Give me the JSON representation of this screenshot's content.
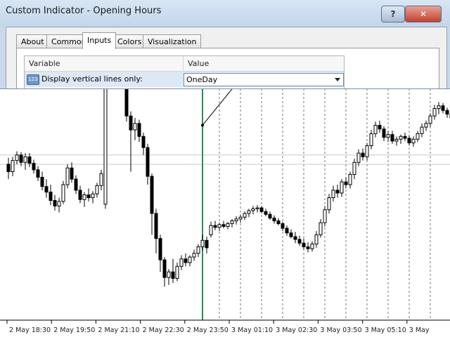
{
  "window": {
    "title": "Custom Indicator - Opening Hours",
    "help_label": "?",
    "close_label": "✕"
  },
  "tabs": [
    {
      "label": "About",
      "active": false
    },
    {
      "label": "Common",
      "active": false
    },
    {
      "label": "Inputs",
      "active": true
    },
    {
      "label": "Colors",
      "active": false
    },
    {
      "label": "Visualization",
      "active": false
    }
  ],
  "inputs_grid": {
    "header_variable": "Variable",
    "header_value": "Value",
    "rows": [
      {
        "icon_text": "123",
        "variable": "Display vertical lines only:",
        "value": "OneDay"
      }
    ]
  },
  "chart_data": {
    "type": "candlestick",
    "x_tick_labels": [
      "2 May 18:30",
      "2 May 19:50",
      "2 May 21:10",
      "2 May 22:30",
      "2 May 23:50",
      "3 May 01:10",
      "3 May 02:30",
      "3 May 03:50",
      "3 May 05:10",
      "3 May"
    ],
    "candles": [
      [
        44.8,
        45.5,
        43.2,
        44.0
      ],
      [
        44.0,
        45.6,
        43.5,
        45.2
      ],
      [
        45.2,
        46.2,
        44.8,
        45.8
      ],
      [
        45.8,
        46.1,
        44.6,
        45.0
      ],
      [
        45.0,
        46.0,
        44.2,
        45.6
      ],
      [
        45.6,
        46.0,
        44.5,
        44.9
      ],
      [
        44.9,
        45.3,
        43.8,
        44.2
      ],
      [
        44.2,
        44.6,
        43.0,
        43.4
      ],
      [
        43.4,
        44.0,
        42.0,
        42.4
      ],
      [
        42.4,
        43.2,
        41.2,
        41.8
      ],
      [
        41.8,
        42.6,
        40.4,
        40.9
      ],
      [
        40.9,
        41.5,
        39.8,
        40.3
      ],
      [
        40.3,
        41.2,
        39.6,
        40.8
      ],
      [
        40.8,
        43.0,
        40.5,
        42.6
      ],
      [
        42.6,
        44.8,
        42.2,
        44.4
      ],
      [
        44.4,
        45.0,
        42.8,
        43.2
      ],
      [
        43.2,
        43.6,
        41.6,
        42.0
      ],
      [
        42.0,
        42.5,
        40.6,
        41.0
      ],
      [
        41.0,
        41.8,
        40.2,
        41.5
      ],
      [
        41.5,
        42.2,
        40.8,
        41.2
      ],
      [
        41.2,
        41.9,
        40.6,
        41.6
      ],
      [
        41.6,
        42.8,
        41.2,
        42.5
      ],
      [
        42.5,
        44.2,
        42.0,
        43.8
      ],
      [
        40.5,
        55.2,
        40.0,
        54.6
      ],
      [
        54.6,
        58.6,
        54.0,
        58.0
      ],
      [
        58.0,
        59.5,
        54.4,
        55.0
      ],
      [
        55.0,
        58.8,
        54.6,
        58.2
      ],
      [
        58.2,
        59.2,
        53.8,
        54.6
      ],
      [
        54.6,
        55.0,
        49.4,
        50.0
      ],
      [
        50.0,
        50.5,
        44.0,
        48.5
      ],
      [
        48.5,
        49.8,
        47.4,
        49.2
      ],
      [
        49.2,
        49.6,
        47.2,
        47.8
      ],
      [
        47.8,
        48.2,
        45.8,
        46.6
      ],
      [
        46.6,
        47.0,
        42.6,
        43.5
      ],
      [
        43.5,
        43.8,
        37.2,
        39.5
      ],
      [
        39.5,
        40.0,
        35.2,
        36.8
      ],
      [
        36.8,
        37.2,
        33.2,
        34.5
      ],
      [
        34.5,
        34.8,
        31.6,
        32.6
      ],
      [
        32.6,
        33.5,
        31.8,
        33.2
      ],
      [
        33.2,
        34.6,
        32.0,
        32.5
      ],
      [
        32.5,
        34.2,
        32.2,
        33.8
      ],
      [
        33.8,
        35.0,
        33.4,
        34.6
      ],
      [
        34.6,
        35.2,
        33.8,
        34.2
      ],
      [
        34.2,
        35.0,
        33.8,
        34.8
      ],
      [
        34.8,
        35.6,
        34.4,
        35.2
      ],
      [
        35.2,
        36.2,
        34.8,
        35.9
      ],
      [
        35.9,
        37.2,
        35.5,
        36.6
      ],
      [
        36.6,
        37.0,
        35.2,
        35.8
      ],
      [
        37.2,
        38.6,
        36.9,
        38.2
      ],
      [
        38.2,
        38.7,
        37.7,
        38.0
      ],
      [
        38.0,
        38.5,
        37.6,
        38.3
      ],
      [
        38.3,
        38.7,
        37.9,
        38.1
      ],
      [
        38.1,
        38.6,
        37.8,
        38.4
      ],
      [
        38.4,
        38.9,
        38.0,
        38.7
      ],
      [
        38.7,
        39.2,
        38.3,
        38.9
      ],
      [
        38.9,
        39.4,
        38.5,
        39.1
      ],
      [
        39.1,
        39.7,
        38.8,
        39.5
      ],
      [
        39.5,
        40.0,
        39.1,
        39.8
      ],
      [
        39.8,
        40.3,
        39.4,
        40.0
      ],
      [
        40.0,
        40.4,
        39.6,
        40.1
      ],
      [
        40.1,
        40.3,
        39.5,
        39.7
      ],
      [
        39.7,
        40.0,
        39.2,
        39.4
      ],
      [
        39.4,
        39.7,
        38.8,
        39.0
      ],
      [
        39.0,
        39.3,
        38.4,
        38.7
      ],
      [
        38.7,
        39.0,
        38.2,
        38.4
      ],
      [
        38.4,
        38.6,
        37.6,
        37.9
      ],
      [
        37.9,
        38.2,
        37.1,
        37.4
      ],
      [
        37.4,
        37.8,
        36.8,
        37.0
      ],
      [
        37.0,
        37.5,
        36.3,
        36.7
      ],
      [
        36.7,
        37.1,
        36.0,
        36.3
      ],
      [
        36.3,
        36.8,
        35.6,
        35.9
      ],
      [
        35.9,
        36.4,
        35.3,
        35.7
      ],
      [
        35.7,
        36.5,
        35.4,
        36.2
      ],
      [
        36.2,
        37.6,
        35.8,
        37.2
      ],
      [
        37.2,
        38.9,
        36.9,
        38.5
      ],
      [
        38.5,
        40.3,
        38.1,
        39.9
      ],
      [
        39.9,
        41.6,
        39.5,
        41.2
      ],
      [
        41.2,
        42.5,
        40.8,
        42.0
      ],
      [
        42.0,
        42.6,
        41.2,
        41.7
      ],
      [
        41.7,
        43.2,
        41.3,
        42.9
      ],
      [
        42.9,
        43.4,
        42.2,
        42.6
      ],
      [
        42.6,
        44.0,
        42.2,
        43.7
      ],
      [
        43.7,
        45.4,
        43.2,
        45.0
      ],
      [
        45.0,
        46.4,
        44.6,
        46.0
      ],
      [
        46.0,
        46.5,
        45.2,
        45.6
      ],
      [
        45.6,
        47.1,
        45.2,
        46.8
      ],
      [
        46.8,
        48.5,
        46.4,
        48.1
      ],
      [
        48.1,
        49.4,
        47.7,
        49.0
      ],
      [
        49.0,
        49.5,
        48.2,
        48.6
      ],
      [
        48.6,
        48.9,
        47.3,
        47.7
      ],
      [
        47.7,
        48.4,
        47.2,
        48.0
      ],
      [
        48.0,
        48.4,
        47.0,
        47.3
      ],
      [
        47.3,
        47.8,
        46.8,
        47.5
      ],
      [
        47.5,
        48.0,
        47.0,
        47.8
      ],
      [
        47.8,
        48.2,
        47.3,
        47.6
      ],
      [
        47.6,
        47.9,
        46.8,
        47.1
      ],
      [
        47.1,
        47.8,
        46.7,
        47.5
      ],
      [
        47.5,
        48.4,
        47.2,
        48.1
      ],
      [
        48.1,
        49.2,
        47.7,
        48.8
      ],
      [
        48.8,
        49.5,
        48.4,
        49.2
      ],
      [
        49.2,
        50.3,
        48.8,
        50.0
      ],
      [
        50.0,
        51.2,
        49.6,
        50.8
      ],
      [
        50.8,
        51.5,
        50.2,
        51.1
      ],
      [
        51.1,
        51.4,
        50.3,
        50.6
      ],
      [
        50.6,
        50.9,
        49.8,
        50.2
      ],
      [
        50.2,
        50.5,
        49.5,
        49.8
      ],
      [
        49.8,
        50.1,
        49.1,
        49.6
      ]
    ],
    "opening_line_index": 46,
    "dashed_line_indices": [
      50,
      55,
      60,
      65,
      70,
      75,
      80,
      85,
      90,
      95,
      100,
      105
    ],
    "horizontal_levels": [
      45.8,
      44.8
    ],
    "trendline": {
      "from": [
        46,
        49.0
      ],
      "to": [
        70,
        62.4
      ]
    },
    "ylim": [
      28,
      62.5
    ],
    "candle_color": "#000000",
    "opening_line_color": "#2e8b57",
    "grid_line_color": "#c8c8c8"
  }
}
